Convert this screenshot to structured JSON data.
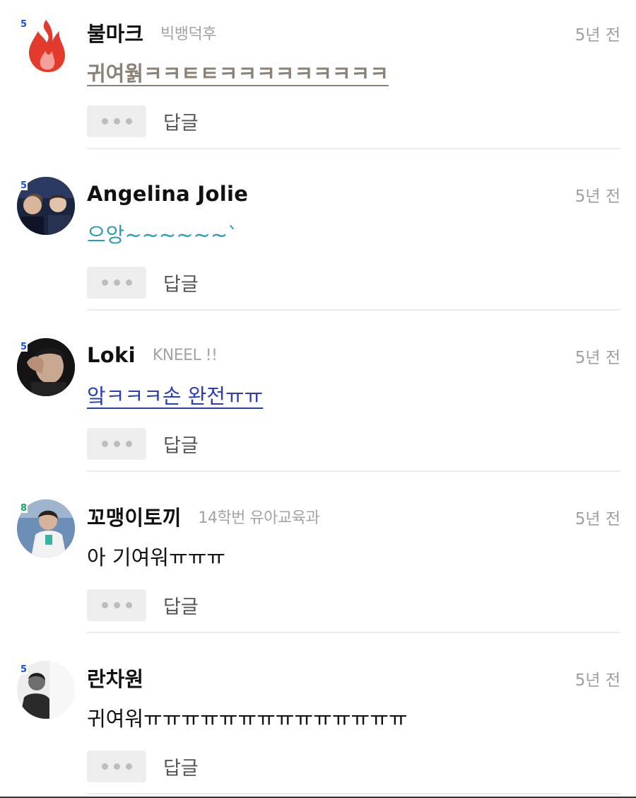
{
  "ui": {
    "reply_label": "답글",
    "more_icon": "more-dots-icon"
  },
  "comments": [
    {
      "level": "5",
      "level_color": "#1a4fd8",
      "nickname": "불마크",
      "subtitle": "빅뱅덕후",
      "time": "5년 전",
      "text": "귀여웕ㅋㅋㅌㅌㅋㅋㅋㅋㅋㅋㅋㅋㅋ",
      "text_color": "#8a8276",
      "avatar": "fire-avatar"
    },
    {
      "level": "5",
      "level_color": "#1a4fd8",
      "nickname": "Angelina Jolie",
      "subtitle": "",
      "time": "5년 전",
      "text": "으앙~~~~~~`",
      "text_color": "#2a9db1",
      "avatar": "photo-avatar"
    },
    {
      "level": "5",
      "level_color": "#1a4fd8",
      "nickname": "Loki",
      "subtitle": "KNEEL !!",
      "time": "5년 전",
      "text": "앜ㅋㅋㅋ손 완전ㅠㅠ",
      "text_color": "#2b3fb1",
      "avatar": "photo-avatar"
    },
    {
      "level": "8",
      "level_color": "#12a36a",
      "nickname": "꼬맹이토끼",
      "subtitle": "14학번 유아교육과",
      "time": "5년 전",
      "text": "아 기여워ㅠㅠㅠ",
      "text_color": "#111111",
      "avatar": "photo-avatar"
    },
    {
      "level": "5",
      "level_color": "#1a4fd8",
      "nickname": "란차원",
      "subtitle": "",
      "time": "5년 전",
      "text": "귀여워ㅠㅠㅠㅠㅠㅠㅠㅠㅠㅠㅠㅠㅠㅠ",
      "text_color": "#111111",
      "avatar": "photo-avatar"
    }
  ]
}
